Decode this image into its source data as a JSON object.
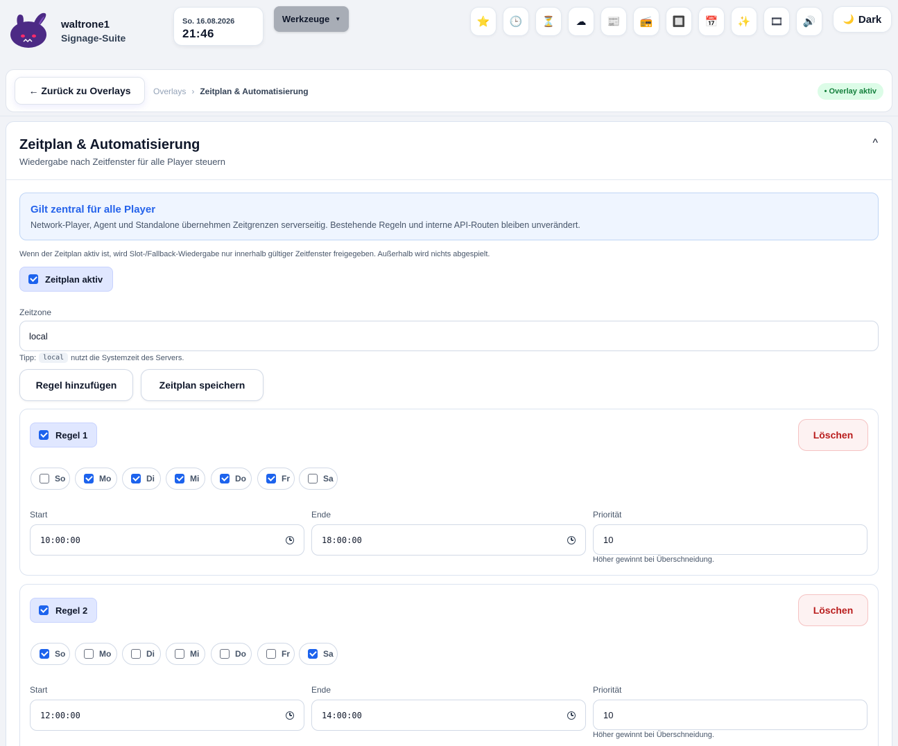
{
  "header": {
    "user": "waltrone1",
    "app": "Signage-Suite",
    "clock_date": "So. 16.08.2026",
    "clock_time": "21:46",
    "tools_label": "Werkzeuge",
    "icons": [
      {
        "name": "star-icon",
        "glyph": "⭐"
      },
      {
        "name": "clock-icon",
        "glyph": "🕒"
      },
      {
        "name": "hourglass-icon",
        "glyph": "⏳"
      },
      {
        "name": "cloud-icon",
        "glyph": "☁"
      },
      {
        "name": "news-icon",
        "glyph": "📰"
      },
      {
        "name": "radio-icon",
        "glyph": "📻"
      },
      {
        "name": "frame-icon",
        "glyph": "🔲"
      },
      {
        "name": "calendar-icon",
        "glyph": "📅"
      },
      {
        "name": "sparkles-icon",
        "glyph": "✨"
      },
      {
        "name": "film-icon",
        "glyph": "🎞"
      },
      {
        "name": "speaker-icon",
        "glyph": "🔊"
      }
    ],
    "theme_label": "Dark",
    "theme_icon": "🌙"
  },
  "breadcrumb": {
    "back_label": "← Zurück zu Overlays",
    "parent": "Overlays",
    "separator": "›",
    "current": "Zeitplan & Automatisierung",
    "status": "• Overlay aktiv"
  },
  "panel": {
    "title": "Zeitplan & Automatisierung",
    "subtitle": "Wiedergabe nach Zeitfenster für alle Player steuern",
    "collapse_glyph": "^",
    "info_title": "Gilt zentral für alle Player",
    "info_text": "Network-Player, Agent und Standalone übernehmen Zeitgrenzen serverseitig. Bestehende Regeln und interne API-Routen bleiben unverändert.",
    "hint": "Wenn der Zeitplan aktiv ist, wird Slot-/Fallback-Wiedergabe nur innerhalb gültiger Zeitfenster freigegeben. Außerhalb wird nichts abgespielt.",
    "schedule_active_label": "Zeitplan aktiv",
    "schedule_active": true,
    "timezone_label": "Zeitzone",
    "timezone_value": "local",
    "tip_prefix": "Tipp:",
    "tip_code": "local",
    "tip_suffix": "nutzt die Systemzeit des Servers.",
    "add_rule_label": "Regel hinzufügen",
    "save_label": "Zeitplan speichern"
  },
  "rules": [
    {
      "label": "Regel 1",
      "enabled": true,
      "delete_label": "Löschen",
      "days": [
        {
          "label": "So",
          "checked": false
        },
        {
          "label": "Mo",
          "checked": true
        },
        {
          "label": "Di",
          "checked": true
        },
        {
          "label": "Mi",
          "checked": true
        },
        {
          "label": "Do",
          "checked": true
        },
        {
          "label": "Fr",
          "checked": true
        },
        {
          "label": "Sa",
          "checked": false
        }
      ],
      "start_label": "Start",
      "start": "10:00:00",
      "end_label": "Ende",
      "end": "18:00:00",
      "priority_label": "Priorität",
      "priority": "10",
      "priority_hint": "Höher gewinnt bei Überschneidung."
    },
    {
      "label": "Regel 2",
      "enabled": true,
      "delete_label": "Löschen",
      "days": [
        {
          "label": "So",
          "checked": true
        },
        {
          "label": "Mo",
          "checked": false
        },
        {
          "label": "Di",
          "checked": false
        },
        {
          "label": "Mi",
          "checked": false
        },
        {
          "label": "Do",
          "checked": false
        },
        {
          "label": "Fr",
          "checked": false
        },
        {
          "label": "Sa",
          "checked": true
        }
      ],
      "start_label": "Start",
      "start": "12:00:00",
      "end_label": "Ende",
      "end": "14:00:00",
      "priority_label": "Priorität",
      "priority": "10",
      "priority_hint": "Höher gewinnt bei Überschneidung."
    }
  ],
  "colors": {
    "accent": "#1d63ed",
    "info_title": "#2563eb",
    "delete": "#b91c1c",
    "status_green": "#15803d"
  }
}
